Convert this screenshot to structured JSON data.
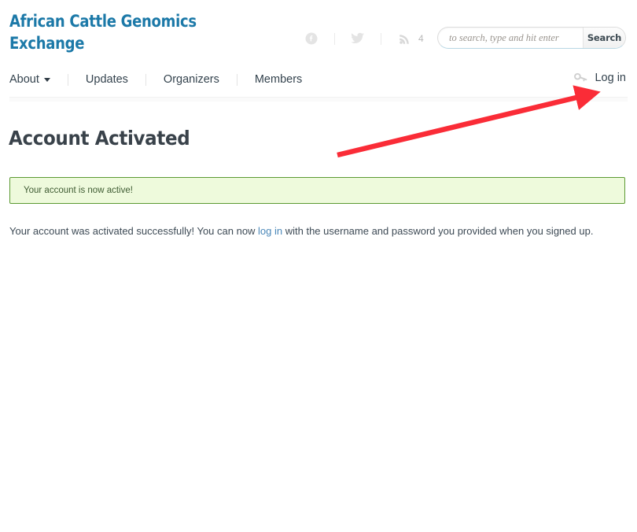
{
  "site": {
    "title": "African Cattle Genomics Exchange"
  },
  "social": {
    "facebook_icon": "facebook-icon",
    "twitter_icon": "twitter-icon",
    "rss_icon": "rss-icon",
    "rss_count": "4"
  },
  "search": {
    "placeholder": "to search, type and hit enter",
    "value": "",
    "button_label": "Search"
  },
  "nav": {
    "items": [
      {
        "label": "About",
        "has_caret": true
      },
      {
        "label": "Updates",
        "has_caret": false
      },
      {
        "label": "Organizers",
        "has_caret": false
      },
      {
        "label": "Members",
        "has_caret": false
      }
    ],
    "login_label": "Log in",
    "login_icon": "key-icon"
  },
  "main": {
    "page_title": "Account Activated",
    "alert": {
      "text": "Your account is now active!",
      "background": "#eefadc",
      "border": "#5c9a33",
      "text_color": "#3f5c33"
    },
    "body": {
      "before_link": "Your account was activated successfully! You can now ",
      "link_label": "log in",
      "after_link": " with the username and password you provided when you signed up."
    }
  },
  "annotation": {
    "arrow_color": "#fa2c37",
    "name": "red-arrow-pointing-to-login"
  },
  "colors": {
    "brand_blue": "#1c79a8",
    "heading": "#39424a",
    "link": "#4a87b8"
  }
}
